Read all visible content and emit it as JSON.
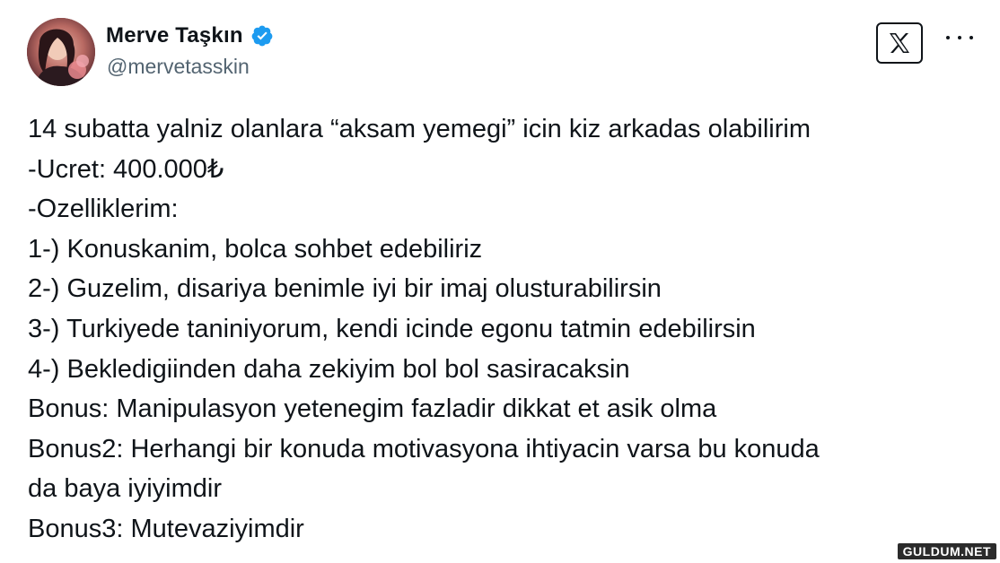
{
  "author": {
    "name": "Merve Taşkın",
    "handle": "@mervetasskin",
    "verified": true,
    "avatar_icon": "profile-photo"
  },
  "header_actions": {
    "x_logo_icon": "x-logo-icon",
    "more_icon": "more-options-icon"
  },
  "tweet": {
    "lines": [
      "14 subatta yalniz olanlara “aksam yemegi” icin kiz arkadas olabilirim",
      "-Ucret: 400.000₺",
      "-Ozelliklerim:",
      "1-) Konuskanim, bolca sohbet edebiliriz",
      "2-) Guzelim, disariya benimle iyi bir imaj olusturabilirsin",
      "3-) Turkiyede taniniyorum, kendi icinde egonu tatmin edebilirsin",
      "4-) Bekledigiinden daha zekiyim bol bol sasiracaksin",
      "Bonus: Manipulasyon yetenegim fazladir dikkat et asik olma",
      "Bonus2: Herhangi bir konuda motivasyona ihtiyacin varsa bu konuda",
      "da baya iyiyimdir",
      "Bonus3: Mutevaziyimdir"
    ]
  },
  "watermark": "GULDUM.NET",
  "colors": {
    "text": "#0f1419",
    "secondary": "#536471",
    "verified": "#1d9bf0",
    "background": "#ffffff"
  }
}
